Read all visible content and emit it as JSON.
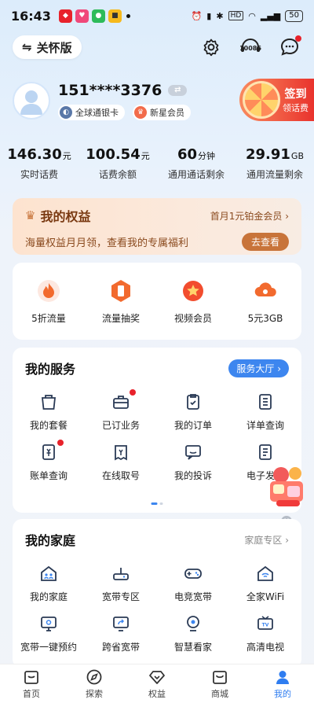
{
  "status_bar": {
    "time": "16:43",
    "battery": "50",
    "network": "HD",
    "apps": [
      "app-red-icon",
      "app-pink-icon",
      "app-green-icon",
      "app-yellow-icon"
    ]
  },
  "header": {
    "care_mode_label": "关怀版",
    "service_number": "10086"
  },
  "profile": {
    "phone": "151****3376",
    "badge1": "全球通银卡",
    "badge2": "新星会员"
  },
  "signin": {
    "main": "签到",
    "sub": "领话费"
  },
  "stats": [
    {
      "value": "146.30",
      "unit": "元",
      "label": "实时话费"
    },
    {
      "value": "100.54",
      "unit": "元",
      "label": "话费余额"
    },
    {
      "value": "60",
      "unit": "分钟",
      "label": "通用通话剩余"
    },
    {
      "value": "29.91",
      "unit": "GB",
      "label": "通用流量剩余"
    }
  ],
  "rights": {
    "title": "我的权益",
    "link": "首月1元铂金会员",
    "desc": "海量权益月月领，查看我的专属福利",
    "button": "去查看"
  },
  "quick": [
    {
      "label": "5折流量",
      "icon": "flame-icon"
    },
    {
      "label": "流量抽奖",
      "icon": "phone-lottery-icon"
    },
    {
      "label": "视频会员",
      "icon": "star-badge-icon"
    },
    {
      "label": "5元3GB",
      "icon": "cloud-data-icon"
    }
  ],
  "services": {
    "title": "我的服务",
    "button": "服务大厅",
    "items": [
      {
        "label": "我的套餐",
        "icon": "bag-icon",
        "dot": false
      },
      {
        "label": "已订业务",
        "icon": "briefcase-icon",
        "dot": true
      },
      {
        "label": "我的订单",
        "icon": "clipboard-check-icon",
        "dot": false
      },
      {
        "label": "详单查询",
        "icon": "list-doc-icon",
        "dot": false
      },
      {
        "label": "账单查询",
        "icon": "bill-icon",
        "dot": true
      },
      {
        "label": "在线取号",
        "icon": "ticket-icon",
        "dot": false
      },
      {
        "label": "我的投诉",
        "icon": "chat-complaint-icon",
        "dot": false
      },
      {
        "label": "电子发票",
        "icon": "invoice-icon",
        "dot": false
      }
    ]
  },
  "family": {
    "title": "我的家庭",
    "link": "家庭专区",
    "items": [
      {
        "label": "我的家庭",
        "icon": "family-home-icon"
      },
      {
        "label": "宽带专区",
        "icon": "router-icon"
      },
      {
        "label": "电竞宽带",
        "icon": "gamepad-icon"
      },
      {
        "label": "全家WiFi",
        "icon": "home-wifi-icon"
      },
      {
        "label": "宽带一键预约",
        "icon": "monitor-icon"
      },
      {
        "label": "跨省宽带",
        "icon": "share-screen-icon"
      },
      {
        "label": "智慧看家",
        "icon": "camera-icon"
      },
      {
        "label": "高清电视",
        "icon": "tv-icon"
      }
    ]
  },
  "tabs": [
    {
      "label": "首页",
      "icon": "home-icon"
    },
    {
      "label": "探索",
      "icon": "compass-icon"
    },
    {
      "label": "权益",
      "icon": "diamond-icon"
    },
    {
      "label": "商城",
      "icon": "shopping-bag-icon"
    },
    {
      "label": "我的",
      "icon": "user-icon",
      "active": true
    }
  ],
  "colors": {
    "accent": "#3d86ef",
    "red": "#e8222b",
    "rights_brown": "#7a3a12"
  }
}
